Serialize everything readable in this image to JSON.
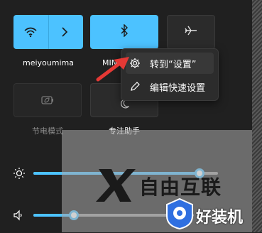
{
  "tiles": {
    "wifi": {
      "label": "meiyoumima",
      "state": "on"
    },
    "bluetooth": {
      "label": "MIN",
      "state": "on"
    },
    "airplane": {
      "label": "",
      "state": "off"
    },
    "battery_saver": {
      "label": "节电模式",
      "state": "off"
    },
    "focus_assist": {
      "label": "专注助手",
      "state": "off"
    }
  },
  "context_menu": {
    "items": [
      {
        "label": "转到“设置”",
        "icon": "gear-icon"
      },
      {
        "label": "编辑快速设置",
        "icon": "pencil-icon"
      }
    ]
  },
  "sliders": {
    "brightness": {
      "icon": "sun-icon",
      "value_percent": 90
    },
    "volume": {
      "icon": "speaker-icon",
      "value_percent": 25
    }
  },
  "watermarks": {
    "center": "自由互联",
    "corner": "好装机"
  },
  "colors": {
    "accent": "#4cc2ff",
    "arrow": "#e53935",
    "background": "#202020"
  }
}
